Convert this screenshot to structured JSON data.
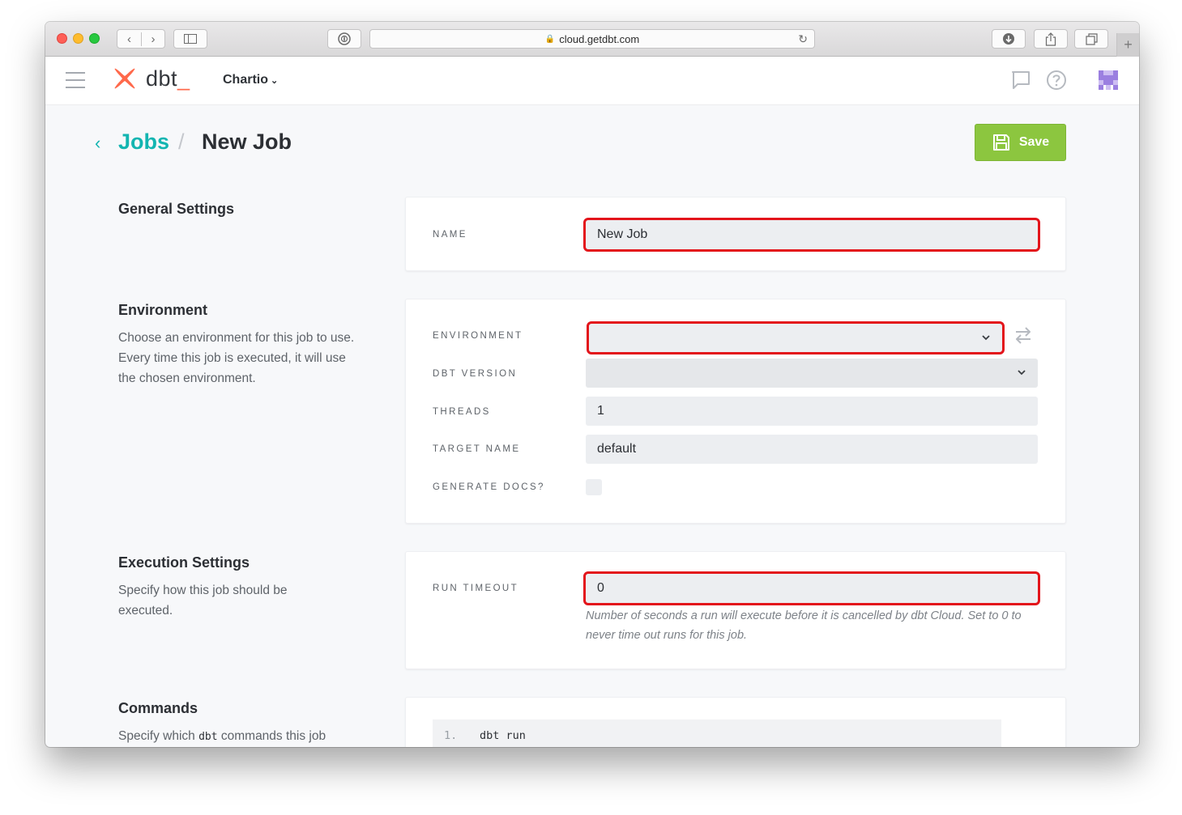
{
  "browser": {
    "url": "cloud.getdbt.com"
  },
  "app": {
    "logo_text": "dbt",
    "logo_cursor": "_",
    "account_name": "Chartio",
    "brand_color": "#ff694b",
    "accent_color": "#13b5b1"
  },
  "page": {
    "breadcrumb_parent": "Jobs",
    "breadcrumb_separator": "/",
    "title": "New Job",
    "save_label": "Save",
    "save_color": "#8cc63f"
  },
  "general": {
    "title": "General Settings",
    "name_label": "NAME",
    "name_value": "New Job"
  },
  "environment": {
    "title": "Environment",
    "description": "Choose an environment for this job to use. Every time this job is executed, it will use the chosen environment.",
    "environment_label": "ENVIRONMENT",
    "environment_value": "",
    "dbt_version_label": "DBT VERSION",
    "dbt_version_value": "",
    "threads_label": "THREADS",
    "threads_value": "1",
    "target_name_label": "TARGET NAME",
    "target_name_value": "default",
    "generate_docs_label": "GENERATE DOCS?",
    "generate_docs_checked": false
  },
  "execution": {
    "title": "Execution Settings",
    "description": "Specify how this job should be executed.",
    "run_timeout_label": "RUN TIMEOUT",
    "run_timeout_value": "0",
    "run_timeout_help": "Number of seconds a run will execute before it is cancelled by dbt Cloud. Set to 0 to never time out runs for this job."
  },
  "commands": {
    "title": "Commands",
    "description_prefix": "Specify which ",
    "description_code": "dbt",
    "description_suffix": " commands this job",
    "lines": [
      {
        "number": "1.",
        "text": "dbt run"
      }
    ]
  },
  "icons": {
    "hamburger": "menu-icon",
    "chat": "chat-icon",
    "help": "help-icon",
    "back": "chevron-left-icon",
    "save": "floppy-disk-icon",
    "swap": "swap-arrows-icon"
  }
}
